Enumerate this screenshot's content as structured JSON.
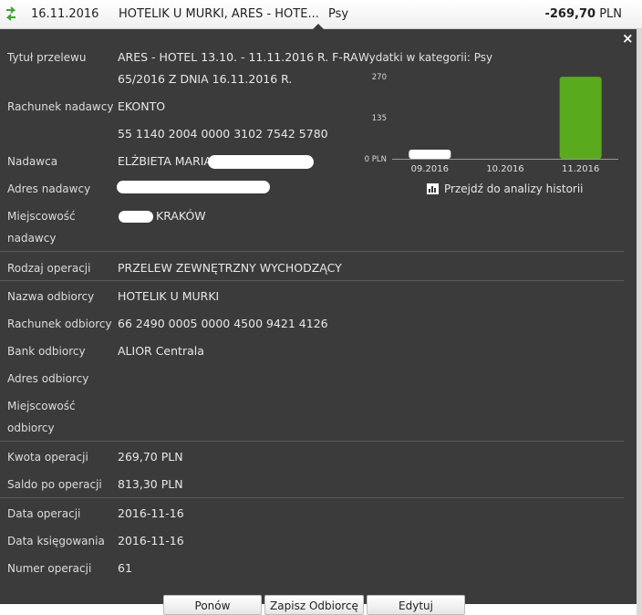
{
  "header": {
    "date": "16.11.2016",
    "title": "HOTELIK U MURKI, ARES - HOTE...",
    "category": "Psy",
    "amount_value": "-269,70",
    "amount_currency": "PLN"
  },
  "details": {
    "tytul_label": "Tytuł przelewu",
    "tytul_line1": "ARES - HOTEL 13.10. - 11.11.2016 R. F-RA",
    "tytul_line2": "65/2016 Z DNIA 16.11.2016 R.",
    "rachunek_nadawcy_label": "Rachunek nadawcy",
    "rachunek_nadawcy_name": "EKONTO",
    "rachunek_nadawcy_number": "55 1140 2004 0000 3102 7542 5780",
    "nadawca_label": "Nadawca",
    "nadawca_value": "ELŻBIETA MARIA",
    "adres_nadawcy_label": "Adres nadawcy",
    "miejscowosc_nadawcy_label_1": "Miejscowość",
    "miejscowosc_nadawcy_label_2": "nadawcy",
    "miejscowosc_nadawcy_value": "KRAKÓW",
    "rodzaj_label": "Rodzaj operacji",
    "rodzaj_value": "PRZELEW ZEWNĘTRZNY WYCHODZĄCY",
    "nazwa_odbiorcy_label": "Nazwa odbiorcy",
    "nazwa_odbiorcy_value": "HOTELIK U MURKI",
    "rachunek_odbiorcy_label": "Rachunek odbiorcy",
    "rachunek_odbiorcy_value": "66 2490 0005 0000 4500 9421 4126",
    "bank_odbiorcy_label": "Bank odbiorcy",
    "bank_odbiorcy_value": "ALIOR Centrala",
    "adres_odbiorcy_label": "Adres odbiorcy",
    "miejscowosc_odbiorcy_label_1": "Miejscowość",
    "miejscowosc_odbiorcy_label_2": "odbiorcy",
    "kwota_label": "Kwota operacji",
    "kwota_value": "269,70 PLN",
    "saldo_label": "Saldo po operacji",
    "saldo_value": "813,30 PLN",
    "data_operacji_label": "Data operacji",
    "data_operacji_value": "2016-11-16",
    "data_ksiegowania_label": "Data księgowania",
    "data_ksiegowania_value": "2016-11-16",
    "numer_label": "Numer operacji",
    "numer_value": "61"
  },
  "chart_data": {
    "type": "bar",
    "title": "Wydatki w kategorii:  Psy",
    "categories": [
      "09.2016",
      "10.2016",
      "11.2016"
    ],
    "values": [
      30,
      0,
      269.7
    ],
    "ylim": [
      0,
      270
    ],
    "yticks": [
      {
        "value": 0,
        "label": "0 PLN"
      },
      {
        "value": 135,
        "label": "135"
      },
      {
        "value": 270,
        "label": "270"
      }
    ],
    "bar_colors": [
      "#ffffff",
      "#ffffff",
      "#5aaa1e"
    ]
  },
  "history_link": "Przejdź do analizy historii",
  "buttons": {
    "repeat": "Ponów",
    "save_recipient": "Zapisz Odbiorcę",
    "edit": "Edytuj"
  },
  "colors": {
    "panel": "#3b3b3b",
    "accent_green": "#5aaa1e"
  }
}
